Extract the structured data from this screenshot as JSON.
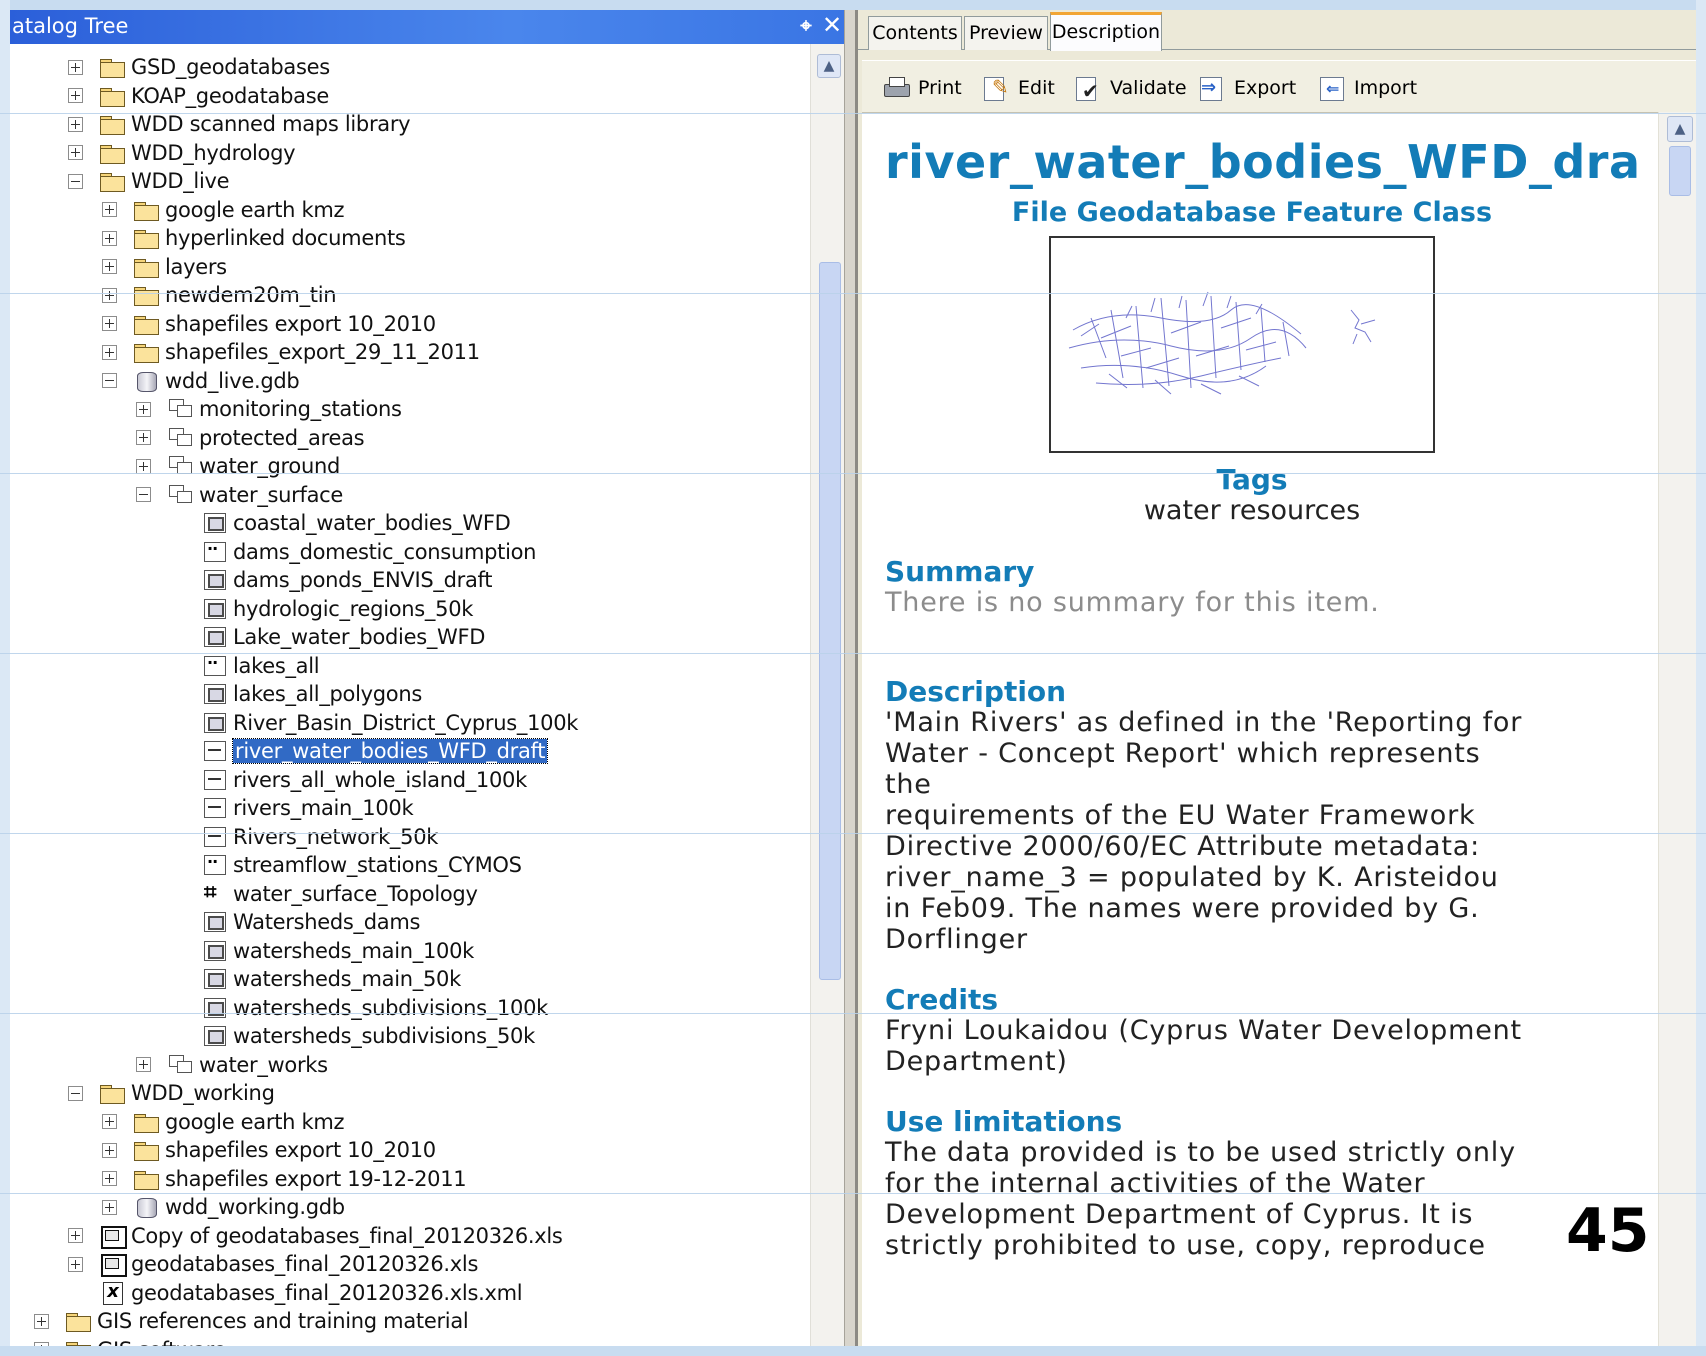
{
  "catalog": {
    "title": "atalog Tree",
    "items": [
      {
        "label": "GSD_geodatabases",
        "indent": 1,
        "expander": "plus",
        "icon": "folder-icon"
      },
      {
        "label": "KOAP_geodatabase",
        "indent": 1,
        "expander": "plus",
        "icon": "folder-icon"
      },
      {
        "label": "WDD scanned maps library",
        "indent": 1,
        "expander": "plus",
        "icon": "folder-icon"
      },
      {
        "label": "WDD_hydrology",
        "indent": 1,
        "expander": "plus",
        "icon": "folder-icon"
      },
      {
        "label": "WDD_live",
        "indent": 1,
        "expander": "minus",
        "icon": "folder-icon"
      },
      {
        "label": "google earth kmz",
        "indent": 2,
        "expander": "plus",
        "icon": "folder-icon"
      },
      {
        "label": "hyperlinked documents",
        "indent": 2,
        "expander": "plus",
        "icon": "folder-icon"
      },
      {
        "label": "layers",
        "indent": 2,
        "expander": "plus",
        "icon": "folder-icon"
      },
      {
        "label": "newdem20m_tin",
        "indent": 2,
        "expander": "plus",
        "icon": "folder-icon"
      },
      {
        "label": "shapefiles export 10_2010",
        "indent": 2,
        "expander": "plus",
        "icon": "folder-icon"
      },
      {
        "label": "shapefiles_export_29_11_2011",
        "indent": 2,
        "expander": "plus",
        "icon": "folder-icon"
      },
      {
        "label": "wdd_live.gdb",
        "indent": 2,
        "expander": "minus",
        "icon": "geodatabase-icon"
      },
      {
        "label": "monitoring_stations",
        "indent": 3,
        "expander": "plus",
        "icon": "feature-dataset-icon"
      },
      {
        "label": "protected_areas",
        "indent": 3,
        "expander": "plus",
        "icon": "feature-dataset-icon"
      },
      {
        "label": "water_ground",
        "indent": 3,
        "expander": "plus",
        "icon": "feature-dataset-icon"
      },
      {
        "label": "water_surface",
        "indent": 3,
        "expander": "minus",
        "icon": "feature-dataset-icon"
      },
      {
        "label": "coastal_water_bodies_WFD",
        "indent": 4,
        "expander": "none",
        "icon": "polygon-feature-class-icon"
      },
      {
        "label": "dams_domestic_consumption",
        "indent": 4,
        "expander": "none",
        "icon": "point-feature-class-icon"
      },
      {
        "label": "dams_ponds_ENVIS_draft",
        "indent": 4,
        "expander": "none",
        "icon": "polygon-feature-class-icon"
      },
      {
        "label": "hydrologic_regions_50k",
        "indent": 4,
        "expander": "none",
        "icon": "polygon-feature-class-icon"
      },
      {
        "label": "Lake_water_bodies_WFD",
        "indent": 4,
        "expander": "none",
        "icon": "polygon-feature-class-icon"
      },
      {
        "label": "lakes_all",
        "indent": 4,
        "expander": "none",
        "icon": "point-feature-class-icon"
      },
      {
        "label": "lakes_all_polygons",
        "indent": 4,
        "expander": "none",
        "icon": "polygon-feature-class-icon"
      },
      {
        "label": "River_Basin_District_Cyprus_100k",
        "indent": 4,
        "expander": "none",
        "icon": "polygon-feature-class-icon"
      },
      {
        "label": "river_water_bodies_WFD_draft",
        "indent": 4,
        "expander": "none",
        "icon": "line-feature-class-icon",
        "selected": true
      },
      {
        "label": "rivers_all_whole_island_100k",
        "indent": 4,
        "expander": "none",
        "icon": "line-feature-class-icon"
      },
      {
        "label": "rivers_main_100k",
        "indent": 4,
        "expander": "none",
        "icon": "line-feature-class-icon"
      },
      {
        "label": "Rivers_network_50k",
        "indent": 4,
        "expander": "none",
        "icon": "line-feature-class-icon"
      },
      {
        "label": "streamflow_stations_CYMOS",
        "indent": 4,
        "expander": "none",
        "icon": "point-feature-class-icon"
      },
      {
        "label": "water_surface_Topology",
        "indent": 4,
        "expander": "none",
        "icon": "topology-icon"
      },
      {
        "label": "Watersheds_dams",
        "indent": 4,
        "expander": "none",
        "icon": "polygon-feature-class-icon"
      },
      {
        "label": "watersheds_main_100k",
        "indent": 4,
        "expander": "none",
        "icon": "polygon-feature-class-icon"
      },
      {
        "label": "watersheds_main_50k",
        "indent": 4,
        "expander": "none",
        "icon": "polygon-feature-class-icon"
      },
      {
        "label": "watersheds_subdivisions_100k",
        "indent": 4,
        "expander": "none",
        "icon": "polygon-feature-class-icon"
      },
      {
        "label": "watersheds_subdivisions_50k",
        "indent": 4,
        "expander": "none",
        "icon": "polygon-feature-class-icon"
      },
      {
        "label": "water_works",
        "indent": 3,
        "expander": "plus",
        "icon": "feature-dataset-icon"
      },
      {
        "label": "WDD_working",
        "indent": 1,
        "expander": "minus",
        "icon": "folder-icon"
      },
      {
        "label": "google earth kmz",
        "indent": 2,
        "expander": "plus",
        "icon": "folder-icon"
      },
      {
        "label": "shapefiles export 10_2010",
        "indent": 2,
        "expander": "plus",
        "icon": "folder-icon"
      },
      {
        "label": "shapefiles export 19-12-2011",
        "indent": 2,
        "expander": "plus",
        "icon": "folder-icon"
      },
      {
        "label": "wdd_working.gdb",
        "indent": 2,
        "expander": "plus",
        "icon": "geodatabase-icon"
      },
      {
        "label": "Copy of geodatabases_final_20120326.xls",
        "indent": 1,
        "expander": "plus",
        "icon": "excel-file-icon"
      },
      {
        "label": "geodatabases_final_20120326.xls",
        "indent": 1,
        "expander": "plus",
        "icon": "excel-file-icon"
      },
      {
        "label": "geodatabases_final_20120326.xls.xml",
        "indent": 1,
        "expander": "none",
        "icon": "xml-file-icon"
      },
      {
        "label": "GIS references and training material",
        "indent": 0,
        "expander": "plus",
        "icon": "folder-icon"
      },
      {
        "label": "GIS software",
        "indent": 0,
        "expander": "plus",
        "icon": "folder-icon"
      }
    ]
  },
  "tabs": [
    {
      "label": "Contents",
      "active": false
    },
    {
      "label": "Preview",
      "active": false
    },
    {
      "label": "Description",
      "active": true
    }
  ],
  "toolbar": {
    "print": "Print",
    "edit": "Edit",
    "validate": "Validate",
    "export": "Export",
    "import": "Import"
  },
  "description": {
    "title": "river_water_bodies_WFD_dra",
    "subtitle": "File Geodatabase Feature Class",
    "tags_heading": "Tags",
    "tags": "water resources",
    "summary_heading": "Summary",
    "summary_text": "There is no summary for this item.",
    "description_heading": "Description",
    "description_lines": [
      "'Main Rivers' as defined in the 'Reporting for",
      "Water - Concept Report' which represents",
      "the",
      "requirements of the EU Water Framework",
      "Directive 2000/60/EC Attribute metadata:",
      "river_name_3 = populated by K. Aristeidou",
      "in Feb09. The names were provided by G.",
      "Dorflinger"
    ],
    "credits_heading": "Credits",
    "credits_lines": [
      "Fryni Loukaidou (Cyprus Water Development",
      "Department)"
    ],
    "use_limitations_heading": "Use limitations",
    "use_limitations_lines": [
      "The data provided is to be used strictly only",
      "for the internal activities of the Water",
      "Development Department of Cyprus. It is",
      "strictly prohibited to use, copy, reproduce"
    ]
  },
  "slide_number": "45",
  "colors": {
    "heading_blue": "#137cb7",
    "selection": "#316ac5",
    "titlebar_blue": "#2b5fd9"
  }
}
